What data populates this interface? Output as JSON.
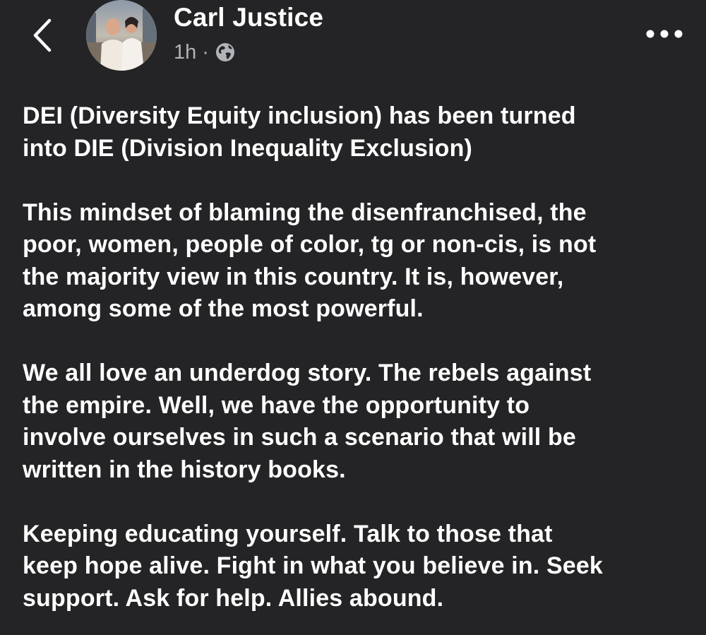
{
  "post": {
    "author": "Carl Justice",
    "time": "1h",
    "separator": "·",
    "audience_icon": "globe-icon",
    "avatar_alt": "Carl Justice profile photo",
    "paragraphs": [
      "DEI (Diversity Equity inclusion) has been turned\ninto DIE (Division Inequality Exclusion)",
      "This mindset of blaming the disenfranchised, the\npoor, women, people of color, tg or non-cis, is not\nthe majority view in this country. It is, however,\namong some of the most powerful.",
      "We all love an underdog story. The rebels against\nthe empire. Well, we have the opportunity to\ninvolve ourselves in such a scenario that will be\nwritten in the history books.",
      "Keeping educating yourself. Talk to those that\nkeep hope alive. Fight in what you believe in. Seek\nsupport. Ask for help. Allies abound."
    ]
  },
  "icons": {
    "back": "chevron-left-icon",
    "more": "more-horizontal-icon"
  },
  "colors": {
    "background": "#242426",
    "text": "#ffffff",
    "meta": "#b0b3b8"
  }
}
